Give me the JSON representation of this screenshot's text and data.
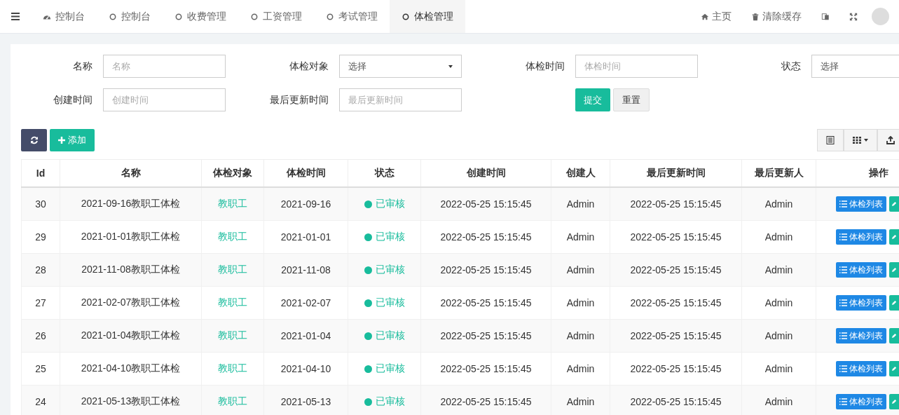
{
  "nav": {
    "tabs": [
      {
        "label": "控制台",
        "selected": false
      },
      {
        "label": "控制台",
        "selected": false
      },
      {
        "label": "收费管理",
        "selected": false
      },
      {
        "label": "工资管理",
        "selected": false
      },
      {
        "label": "考试管理",
        "selected": false
      },
      {
        "label": "体检管理",
        "selected": true
      }
    ],
    "links": [
      "主页",
      "清除缓存"
    ]
  },
  "filters": [
    {
      "label": "名称",
      "kind": "text",
      "placeholder": "名称"
    },
    {
      "label": "体检对象",
      "kind": "select",
      "value": "选择"
    },
    {
      "label": "体检时间",
      "kind": "text",
      "placeholder": "体检时间"
    },
    {
      "label": "状态",
      "kind": "select",
      "value": "选择"
    },
    {
      "label": "创建时间",
      "kind": "text",
      "placeholder": "创建时间"
    },
    {
      "label": "最后更新时间",
      "kind": "text",
      "placeholder": "最后更新时间"
    }
  ],
  "form_buttons": [
    {
      "label": "提交",
      "kind": "primary"
    },
    {
      "label": "重置",
      "kind": "default"
    }
  ],
  "toolbar": {
    "add_label": "添加"
  },
  "table": {
    "columns": [
      "Id",
      "名称",
      "体检对象",
      "体检时间",
      "状态",
      "创建时间",
      "创建人",
      "最后更新时间",
      "最后更新人",
      "操作"
    ],
    "rows": [
      {
        "id": "30",
        "name": "2021-09-16教职工体检",
        "target": "教职工",
        "date": "2021-09-16",
        "status": "已审核",
        "color": "#18bc9c",
        "created": "2022-05-25 15:15:45",
        "creator": "Admin",
        "updated": "2022-05-25 15:15:45",
        "updater": "Admin",
        "action": "体检列表"
      },
      {
        "id": "29",
        "name": "2021-01-01教职工体检",
        "target": "教职工",
        "date": "2021-01-01",
        "status": "已审核",
        "color": "#18bc9c",
        "created": "2022-05-25 15:15:45",
        "creator": "Admin",
        "updated": "2022-05-25 15:15:45",
        "updater": "Admin",
        "action": "体检列表"
      },
      {
        "id": "28",
        "name": "2021-11-08教职工体检",
        "target": "教职工",
        "date": "2021-11-08",
        "status": "已审核",
        "color": "#18bc9c",
        "created": "2022-05-25 15:15:45",
        "creator": "Admin",
        "updated": "2022-05-25 15:15:45",
        "updater": "Admin",
        "action": "体检列表"
      },
      {
        "id": "27",
        "name": "2021-02-07教职工体检",
        "target": "教职工",
        "date": "2021-02-07",
        "status": "已审核",
        "color": "#18bc9c",
        "created": "2022-05-25 15:15:45",
        "creator": "Admin",
        "updated": "2022-05-25 15:15:45",
        "updater": "Admin",
        "action": "体检列表"
      },
      {
        "id": "26",
        "name": "2021-01-04教职工体检",
        "target": "教职工",
        "date": "2021-01-04",
        "status": "已审核",
        "color": "#18bc9c",
        "created": "2022-05-25 15:15:45",
        "creator": "Admin",
        "updated": "2022-05-25 15:15:45",
        "updater": "Admin",
        "action": "体检列表"
      },
      {
        "id": "25",
        "name": "2021-04-10教职工体检",
        "target": "教职工",
        "date": "2021-04-10",
        "status": "已审核",
        "color": "#18bc9c",
        "created": "2022-05-25 15:15:45",
        "creator": "Admin",
        "updated": "2022-05-25 15:15:45",
        "updater": "Admin",
        "action": "体检列表"
      },
      {
        "id": "24",
        "name": "2021-05-13教职工体检",
        "target": "教职工",
        "date": "2021-05-13",
        "status": "已审核",
        "color": "#18bc9c",
        "created": "2022-05-25 15:15:45",
        "creator": "Admin",
        "updated": "2022-05-25 15:15:45",
        "updater": "Admin",
        "action": "体检列表"
      }
    ]
  }
}
